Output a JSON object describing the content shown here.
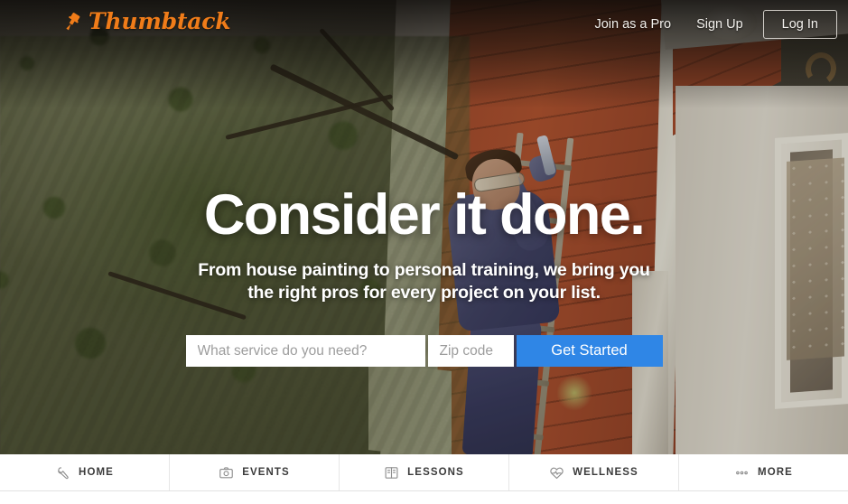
{
  "brand": {
    "name": "Thumbtack",
    "logo_icon": "pushpin-icon",
    "accent_color": "#f07c19"
  },
  "header": {
    "links": [
      {
        "label": "Join as a Pro",
        "name": "join-as-pro-link"
      },
      {
        "label": "Sign Up",
        "name": "sign-up-link"
      }
    ],
    "login_label": "Log In"
  },
  "hero": {
    "headline": "Consider it done.",
    "subhead_line1": "From house painting to personal training, we bring you",
    "subhead_line2": "the right pros for every project on your list.",
    "image_description": "House painter in blue coveralls and safety goggles on a ladder painting red siding, trees at left"
  },
  "search": {
    "service_placeholder": "What service do you need?",
    "service_value": "",
    "zip_placeholder": "Zip code",
    "zip_value": "",
    "submit_label": "Get Started",
    "submit_color": "#2f86e6"
  },
  "category_nav": {
    "items": [
      {
        "label": "HOME",
        "icon": "wrench-icon"
      },
      {
        "label": "EVENTS",
        "icon": "camera-icon"
      },
      {
        "label": "LESSONS",
        "icon": "book-icon"
      },
      {
        "label": "WELLNESS",
        "icon": "heart-pulse-icon"
      },
      {
        "label": "MORE",
        "icon": "ellipsis-icon"
      }
    ]
  }
}
